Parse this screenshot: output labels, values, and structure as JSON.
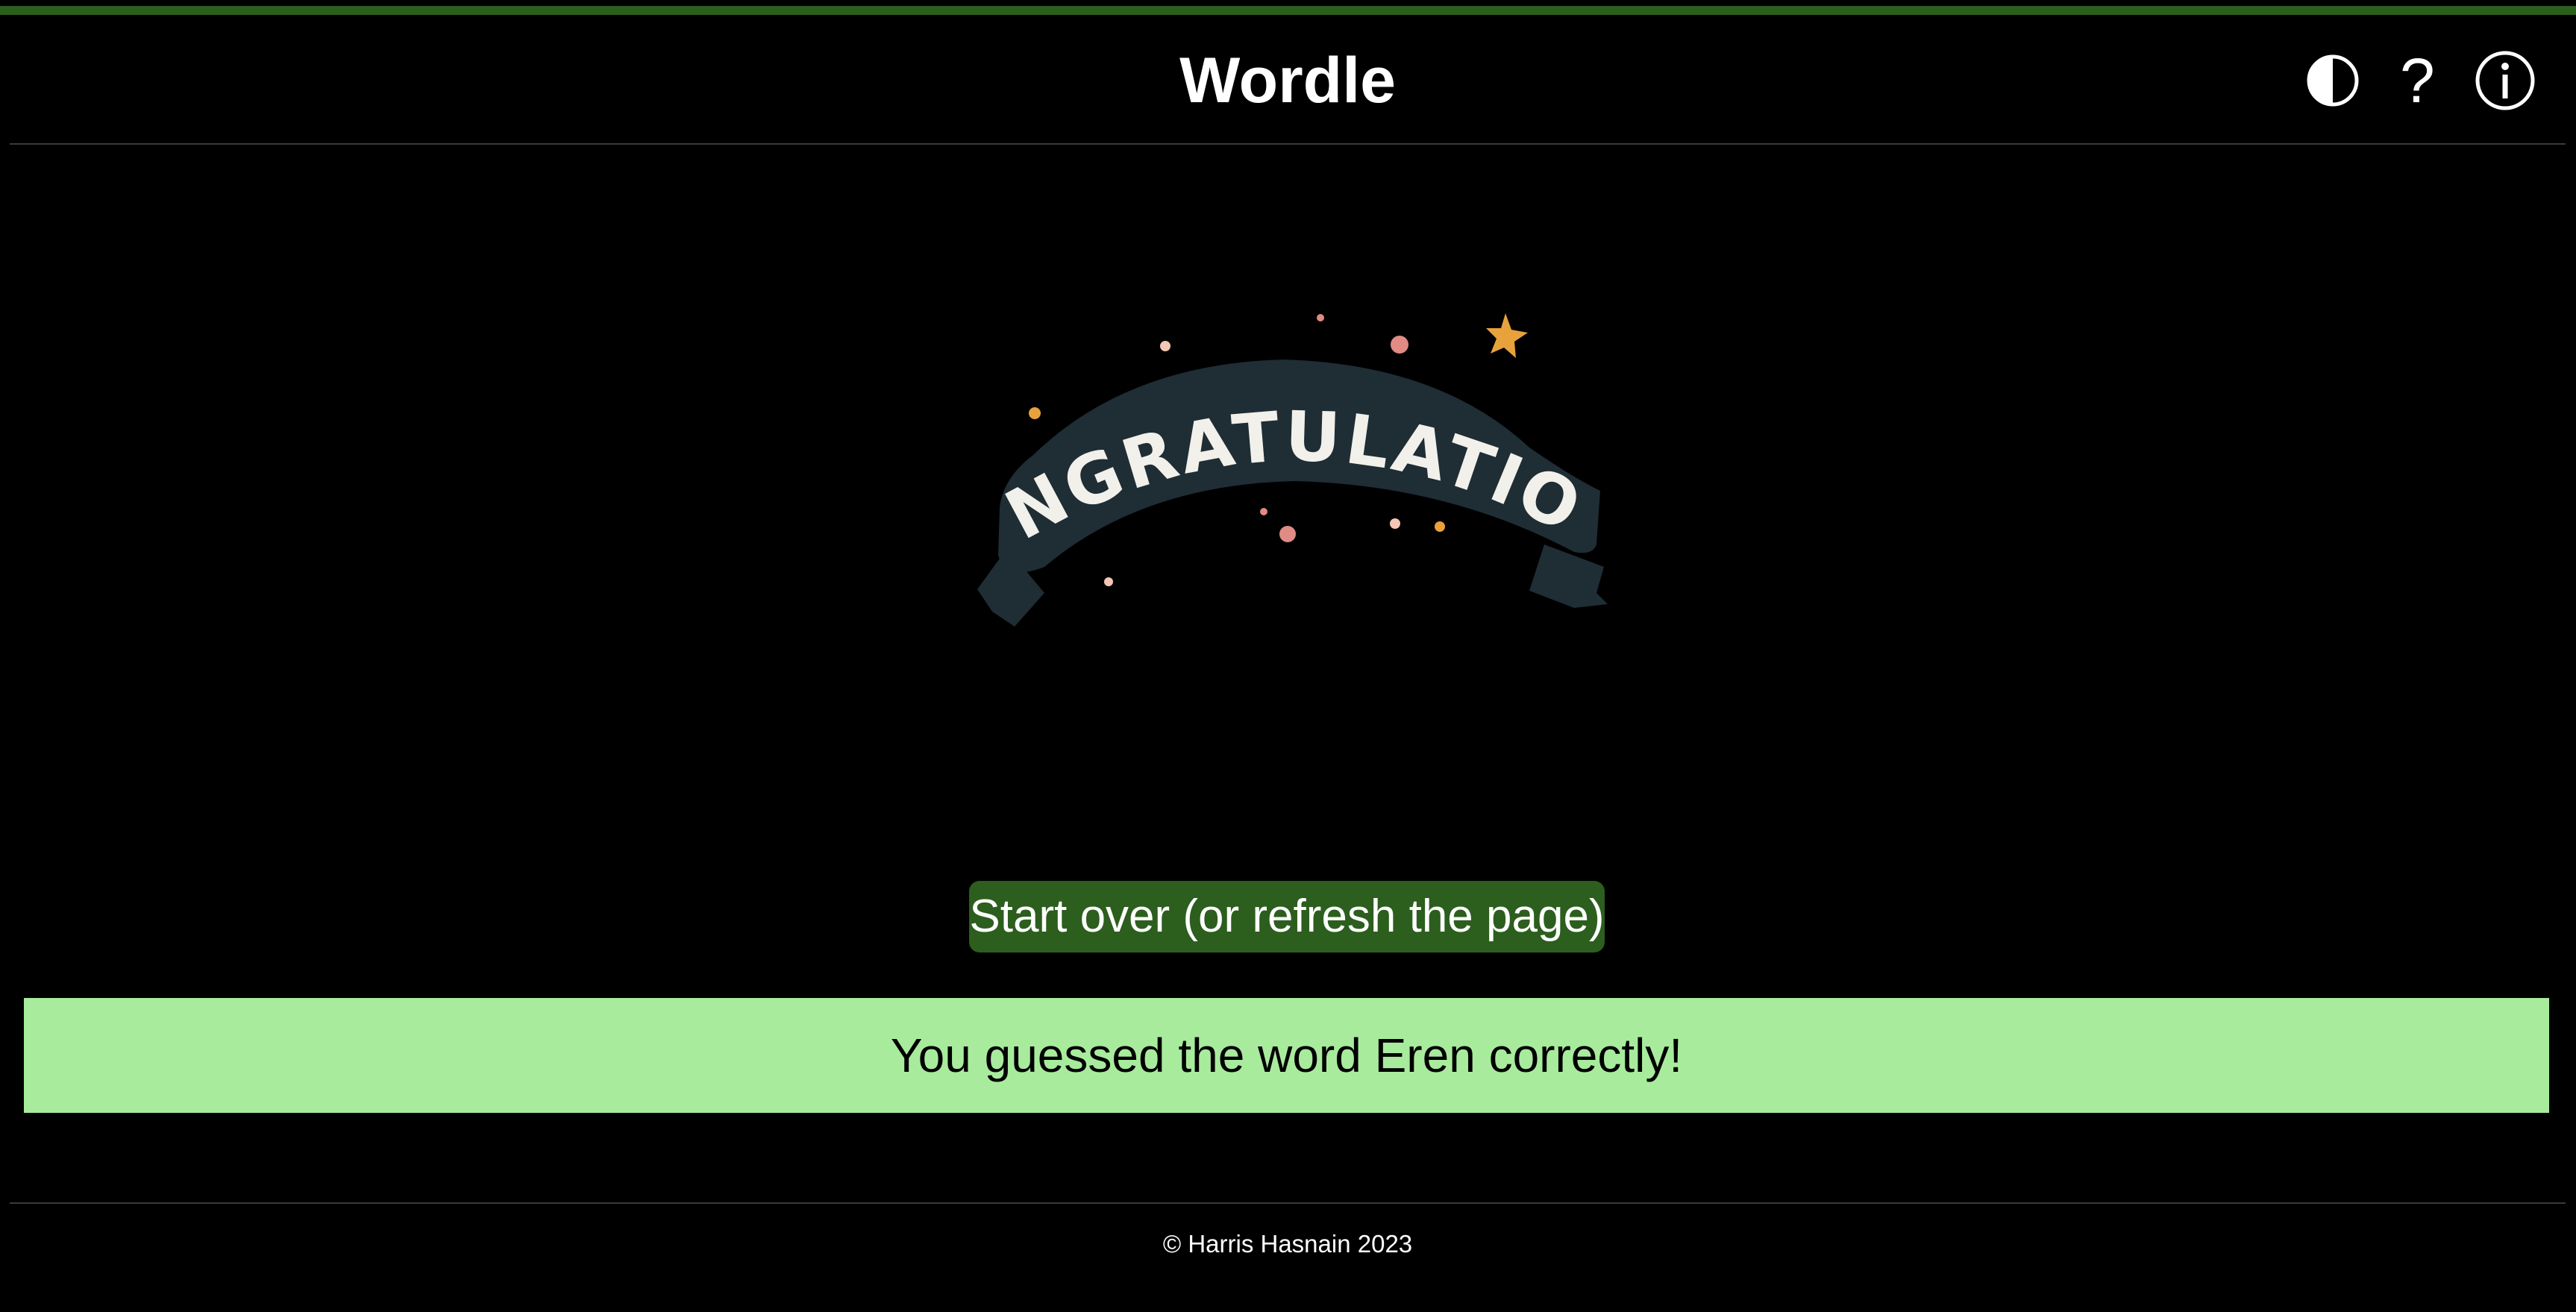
{
  "header": {
    "title": "Wordle",
    "icons": [
      "contrast-icon",
      "help-icon",
      "info-icon"
    ],
    "help_glyph": "?"
  },
  "celebration": {
    "banner_text": "CONGRATULATIONS",
    "banner_color": "#1f2d35",
    "confetti_colors": [
      "#e8a23c",
      "#e08b84",
      "#f4c6b4"
    ]
  },
  "actions": {
    "start_over_label": "Start over (or refresh the page)"
  },
  "result": {
    "message": "You guessed the word Eren correctly!"
  },
  "footer": {
    "copyright": "© Harris Hasnain 2023"
  },
  "colors": {
    "background": "#000000",
    "accent_green": "#2c5e1e",
    "success_bg": "#a8eb9d",
    "divider": "#3a3a3a"
  }
}
